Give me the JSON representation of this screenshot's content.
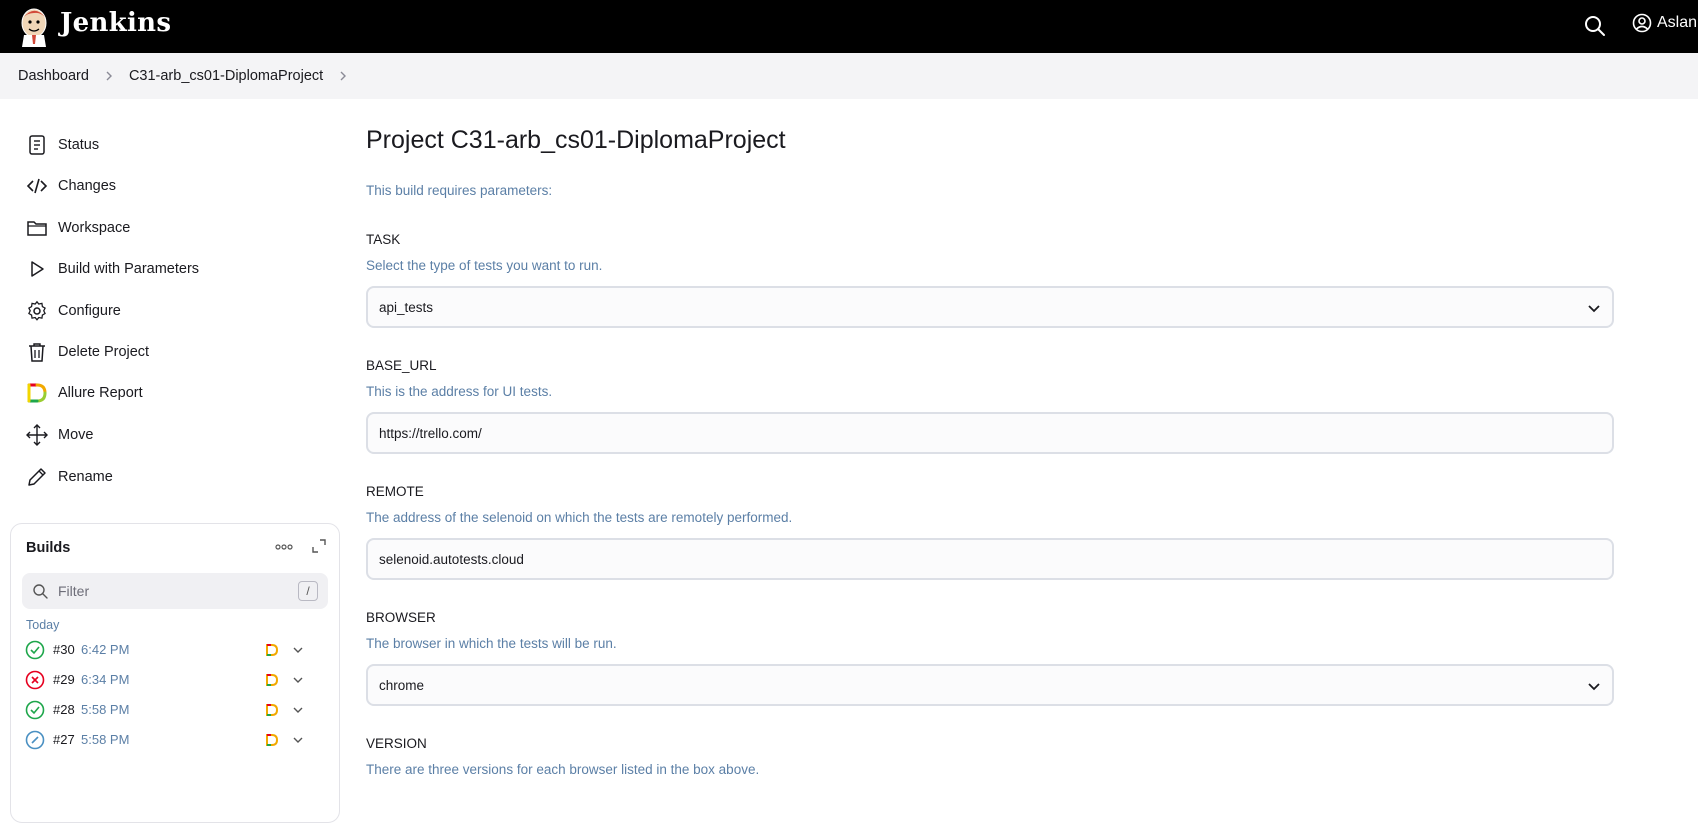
{
  "header": {
    "app_name": "Jenkins",
    "user_name": "Aslan",
    "icons": {
      "logo": "jenkins-logo",
      "search": "search-icon",
      "user": "user-icon"
    },
    "background": "#000000"
  },
  "breadcrumb": {
    "items": [
      "Dashboard",
      "C31-arb_cs01-DiplomaProject"
    ]
  },
  "sidebar": {
    "tasks": [
      {
        "label": "Status",
        "icon": "status-icon"
      },
      {
        "label": "Changes",
        "icon": "code-icon"
      },
      {
        "label": "Workspace",
        "icon": "folder-icon"
      },
      {
        "label": "Build with Parameters",
        "icon": "play-icon"
      },
      {
        "label": "Configure",
        "icon": "gear-icon"
      },
      {
        "label": "Delete Project",
        "icon": "trash-icon"
      },
      {
        "label": "Allure Report",
        "icon": "allure-icon"
      },
      {
        "label": "Move",
        "icon": "move-icon"
      },
      {
        "label": "Rename",
        "icon": "pencil-icon"
      }
    ],
    "builds": {
      "title": "Builds",
      "filter_placeholder": "Filter",
      "filter_shortcut": "/",
      "group_label": "Today",
      "items": [
        {
          "number": "#30",
          "time": "6:42 PM",
          "status": "success"
        },
        {
          "number": "#29",
          "time": "6:34 PM",
          "status": "failed"
        },
        {
          "number": "#28",
          "time": "5:58 PM",
          "status": "success"
        },
        {
          "number": "#27",
          "time": "5:58 PM",
          "status": "aborted"
        }
      ]
    }
  },
  "main": {
    "title": "Project C31-arb_cs01-DiplomaProject",
    "requires_text": "This build requires parameters:",
    "params": [
      {
        "name": "TASK",
        "description": "Select the type of tests you want to run.",
        "value": "api_tests",
        "type": "select"
      },
      {
        "name": "BASE_URL",
        "description": "This is the address for UI tests.",
        "value": "https://trello.com/",
        "type": "text"
      },
      {
        "name": "REMOTE",
        "description": "The address of the selenoid on which the tests are remotely performed.",
        "value": "selenoid.autotests.cloud",
        "type": "text"
      },
      {
        "name": "BROWSER",
        "description": "The browser in which the tests will be run.",
        "value": "chrome",
        "type": "select"
      },
      {
        "name": "VERSION",
        "description": "There are three versions for each browser listed in the box above.",
        "value": "",
        "type": "select"
      }
    ]
  },
  "colors": {
    "accent_text": "#5b7fa6",
    "success": "#1ea64b",
    "failed": "#e6001f",
    "aborted": "#4a90c2",
    "breadcrumb_bg": "#f4f4f6"
  }
}
